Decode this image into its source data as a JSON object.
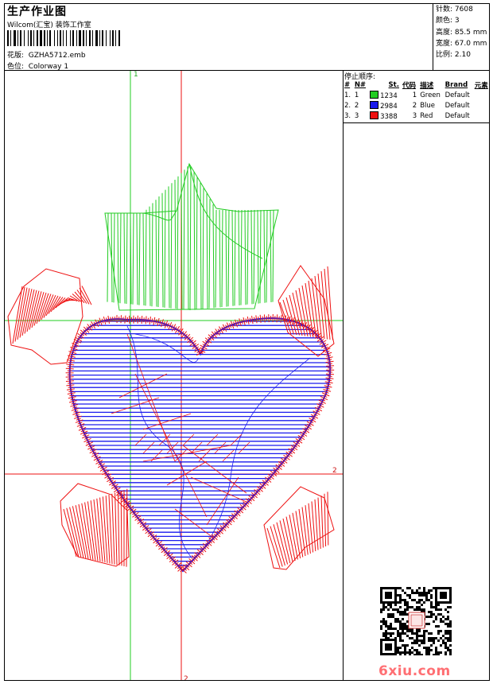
{
  "header": {
    "title": "生产作业图",
    "company": "Wilcom(汇宝) 装饰工作室",
    "file_label": "花版:",
    "file_name": "GZHA5712.emb",
    "colorway_label": "色位:",
    "colorway": "Colorway 1"
  },
  "stats": {
    "stitches_label": "针数:",
    "stitches": "7608",
    "colors_label": "颜色:",
    "colors": "3",
    "height_label": "高度:",
    "height": "85.5 mm",
    "width_label": "宽度:",
    "width": "67.0 mm",
    "scale_label": "比例:",
    "scale": "2.10"
  },
  "stop_sequence": {
    "title": "停止顺序:",
    "columns": [
      "#",
      "N#",
      "St.",
      "代码",
      "描述",
      "Brand",
      "元素"
    ],
    "rows": [
      {
        "idx": "1.",
        "n": "1",
        "stitches": "1234",
        "code": "1",
        "desc": "Green",
        "brand": "Default",
        "color": "#22cc22"
      },
      {
        "idx": "2.",
        "n": "2",
        "stitches": "2984",
        "code": "2",
        "desc": "Blue",
        "brand": "Default",
        "color": "#1a1aee"
      },
      {
        "idx": "3.",
        "n": "3",
        "stitches": "3388",
        "code": "3",
        "desc": "Red",
        "brand": "Default",
        "color": "#ee1111"
      }
    ]
  },
  "axes": {
    "green_v_label": "1",
    "red_h_label": "2",
    "red_v_label": "2"
  },
  "colors": {
    "green": "#22cc22",
    "blue": "#1a1aee",
    "red": "#ee1111"
  },
  "watermark": "6xiu.com",
  "qr_icon": "qr-code-icon"
}
